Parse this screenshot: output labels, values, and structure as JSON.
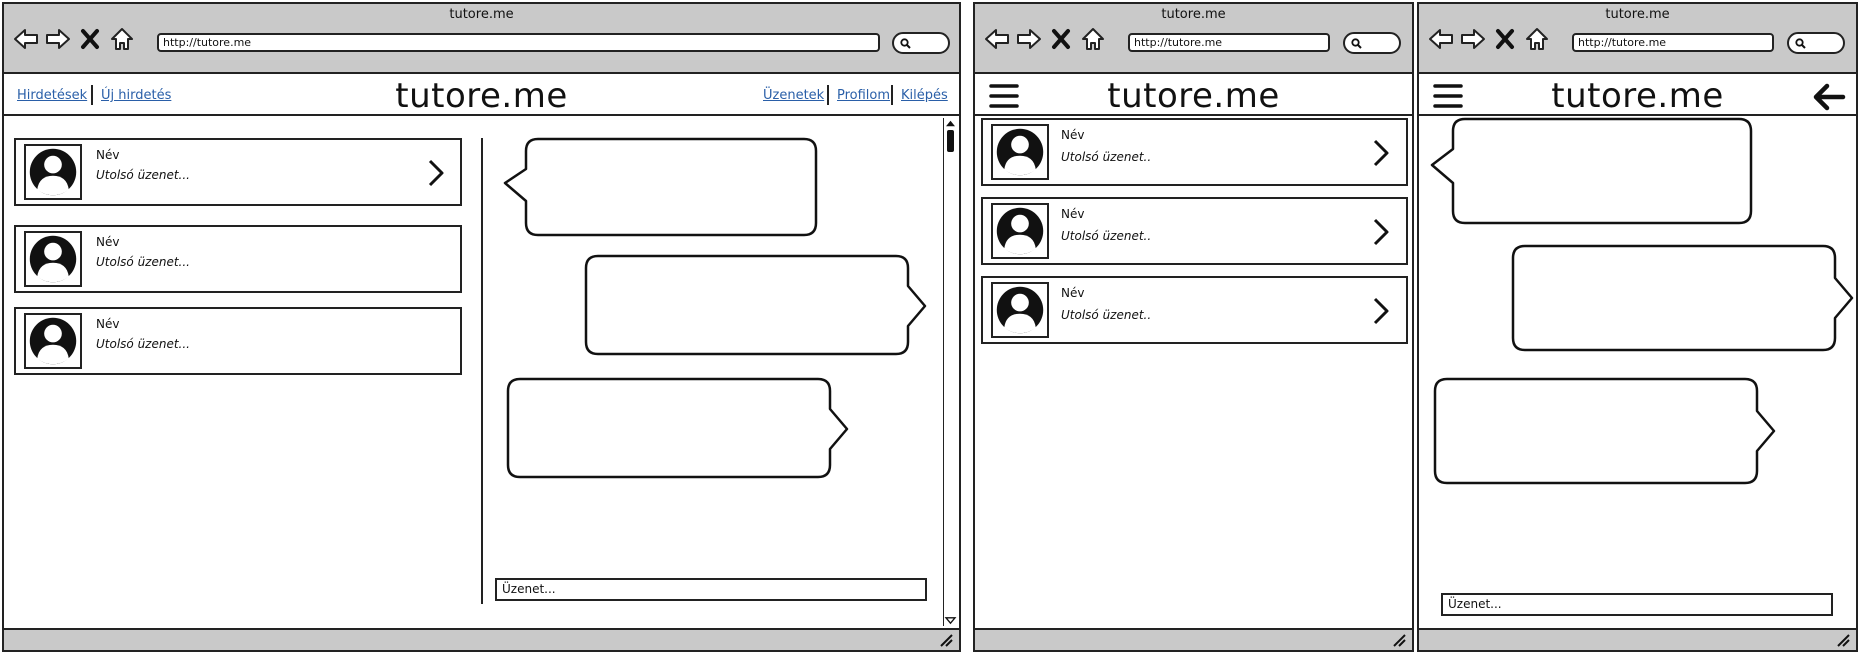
{
  "desktop": {
    "window_title": "tutore.me",
    "url": "http://tutore.me",
    "logo": "tutore.me",
    "nav_left": [
      "Hirdetések",
      "Új hirdetés"
    ],
    "nav_right": [
      "Üzenetek",
      "Profilom",
      "Kilépés"
    ],
    "conversations": [
      {
        "name": "Név",
        "last_message": "Utolsó üzenet..."
      },
      {
        "name": "Név",
        "last_message": "Utolsó üzenet..."
      },
      {
        "name": "Név",
        "last_message": "Utolsó üzenet..."
      }
    ],
    "message_placeholder": "Üzenet..."
  },
  "mobile_list": {
    "window_title": "tutore.me",
    "url": "http://tutore.me",
    "logo": "tutore.me",
    "conversations": [
      {
        "name": "Név",
        "last_message": "Utolsó üzenet.."
      },
      {
        "name": "Név",
        "last_message": "Utolsó üzenet.."
      },
      {
        "name": "Név",
        "last_message": "Utolsó üzenet.."
      }
    ]
  },
  "mobile_chat": {
    "window_title": "tutore.me",
    "url": "http://tutore.me",
    "logo": "tutore.me",
    "message_placeholder": "Üzenet..."
  },
  "icons": {
    "back": "back-arrow-icon",
    "forward": "forward-arrow-icon",
    "stop": "close-icon",
    "home": "home-icon",
    "search": "search-icon",
    "menu": "hamburger-menu-icon",
    "avatar": "user-avatar-icon",
    "open": "chevron-right-icon",
    "back_nav": "arrow-left-icon",
    "resize": "resize-grip-icon"
  }
}
